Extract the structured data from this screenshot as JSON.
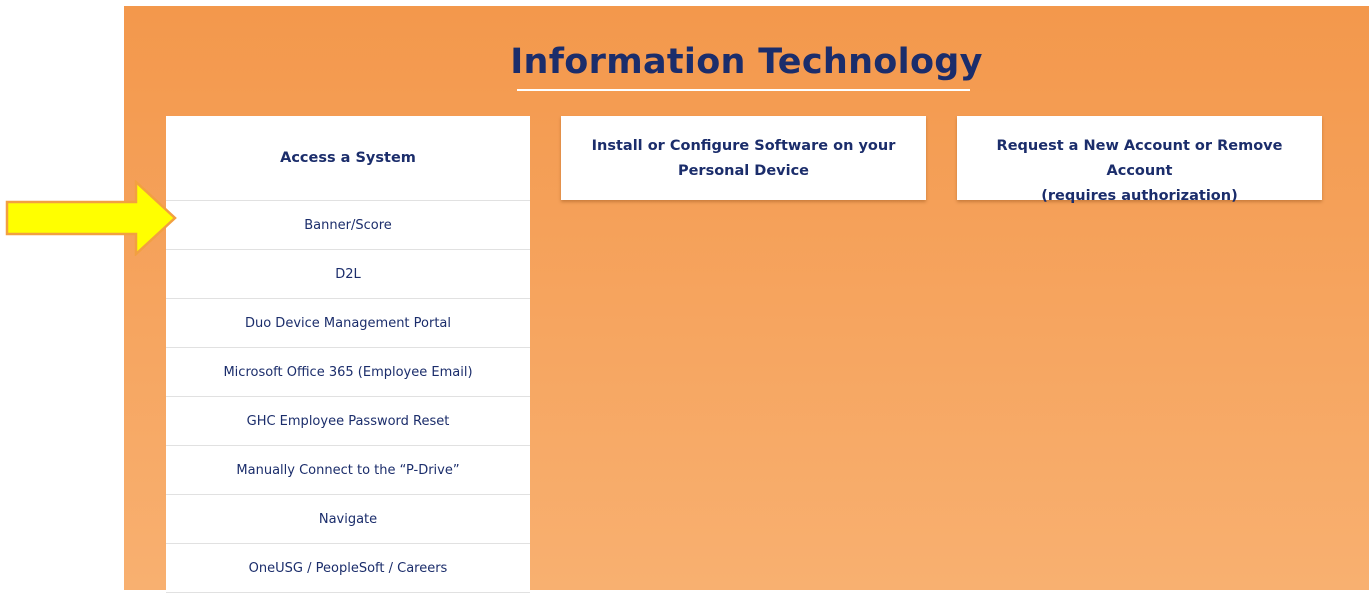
{
  "page": {
    "title": "Information Technology"
  },
  "colors": {
    "panel_top": "#f3984c",
    "panel_bottom": "#f8b070",
    "text_navy": "#1b2d6b",
    "arrow_fill": "#ffff00",
    "arrow_stroke": "#f2a041"
  },
  "cards": {
    "access": {
      "title": "Access a System",
      "items": [
        "Banner/Score",
        "D2L",
        "Duo Device Management Portal",
        "Microsoft Office 365 (Employee Email)",
        "GHC Employee Password Reset",
        "Manually Connect to the “P-Drive”",
        "Navigate",
        "OneUSG / PeopleSoft / Careers"
      ]
    },
    "install": {
      "title_line1": "Install or Configure Software on your",
      "title_line2": "Personal Device"
    },
    "request": {
      "title_line1": "Request a New Account or Remove Account",
      "title_line2": "(requires authorization)"
    }
  },
  "annotation": {
    "icon": "arrow-right-icon"
  }
}
